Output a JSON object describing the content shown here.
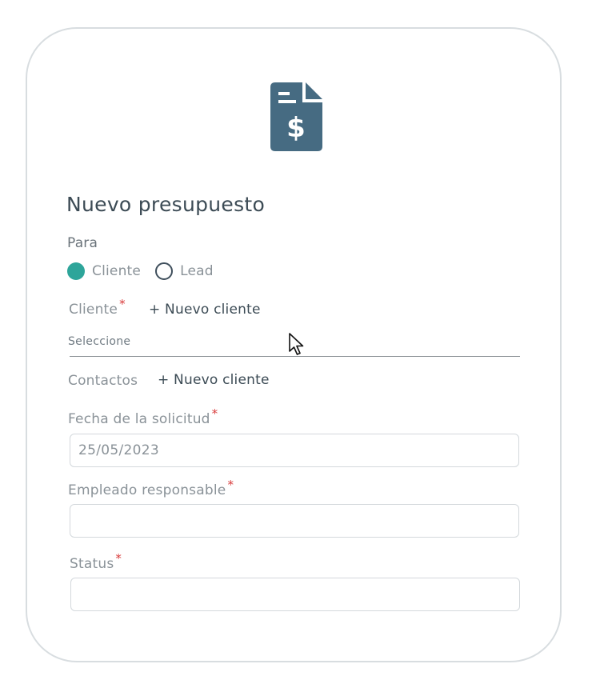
{
  "form": {
    "title": "Nuevo presupuesto",
    "para_label": "Para",
    "radio_options": [
      {
        "label": "Cliente",
        "selected": true
      },
      {
        "label": "Lead",
        "selected": false
      }
    ],
    "cliente_label": "Cliente",
    "cliente_add_link": "+ Nuevo cliente",
    "cliente_placeholder": "Seleccione",
    "contactos_label": "Contactos",
    "contactos_add_link": "+ Nuevo cliente",
    "fecha_label": "Fecha de la solicitud",
    "fecha_value": "25/05/2023",
    "empleado_label": "Empleado responsable",
    "empleado_value": "",
    "status_label": "Status",
    "status_value": "",
    "required_mark": "*"
  },
  "colors": {
    "accent": "#2ea59a",
    "icon": "#466b82",
    "title": "#3c4b55",
    "required": "#d83a3a",
    "border": "#d8dde0"
  },
  "icons": {
    "header": "invoice-dollar-document-icon",
    "cursor": "mouse-pointer-icon"
  }
}
